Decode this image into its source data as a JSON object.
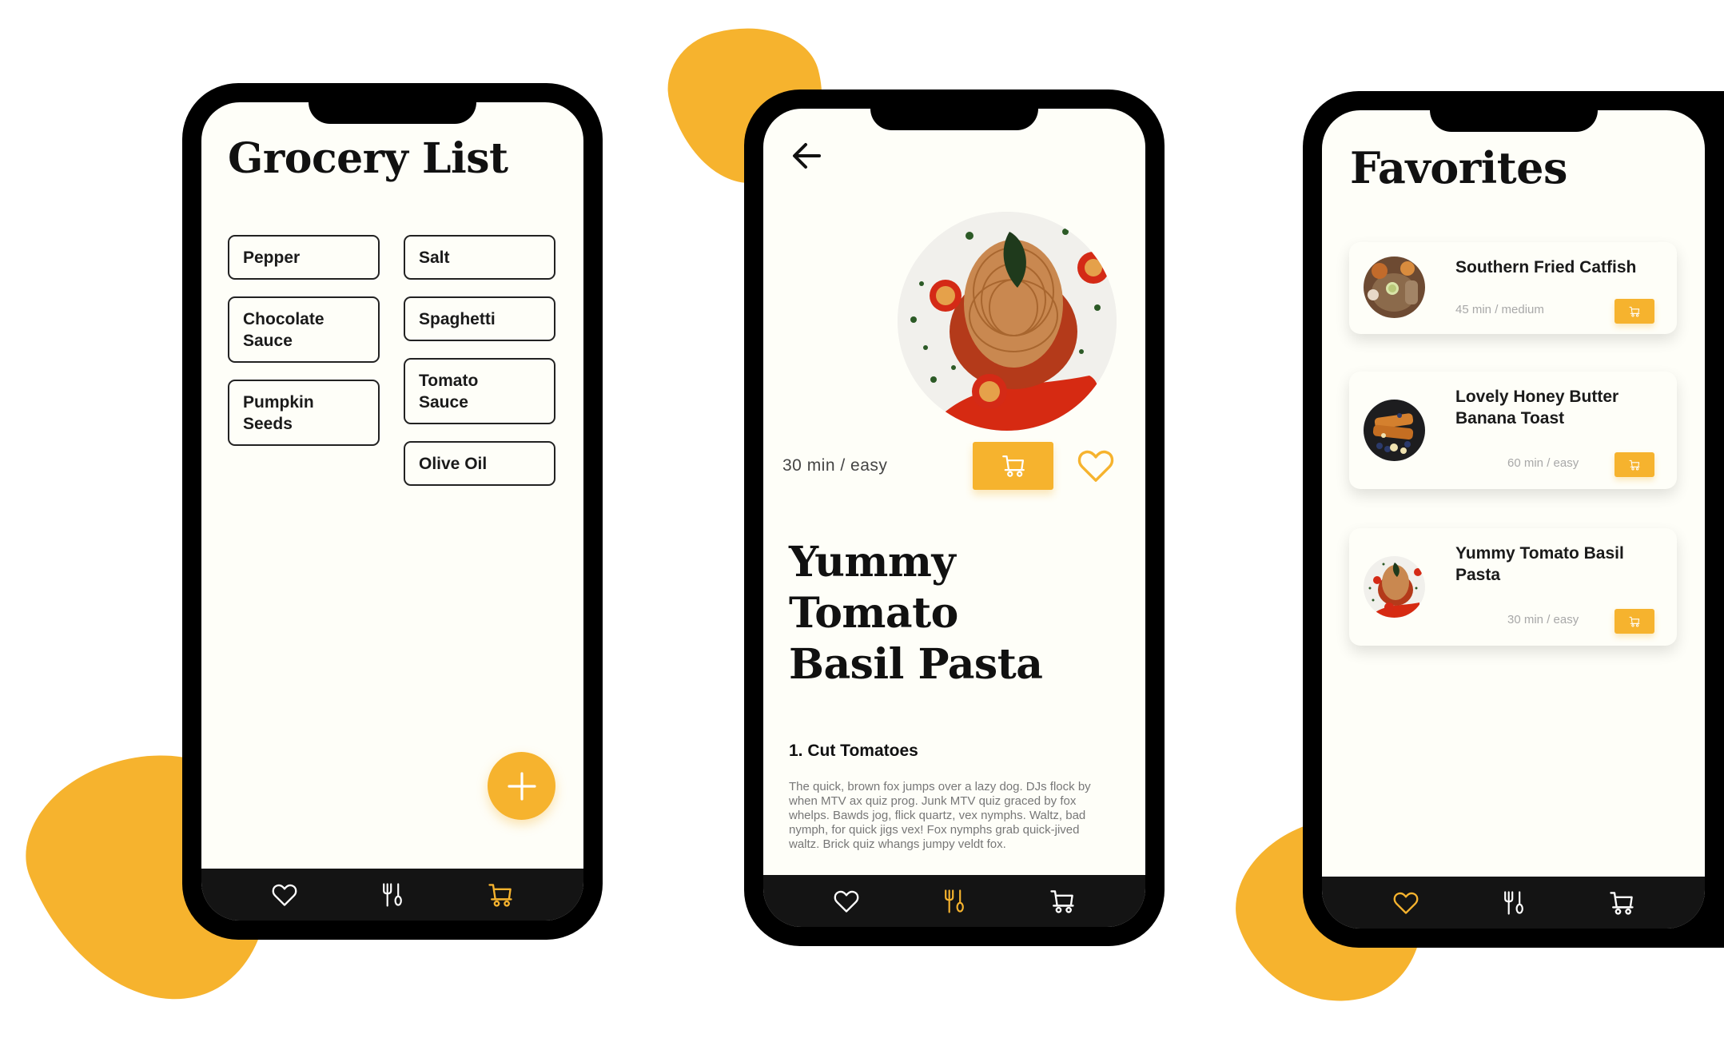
{
  "colors": {
    "accent": "#F6B32E",
    "screen_bg": "#FEFEF8",
    "tabbar_bg": "#141414",
    "text_dark": "#111111",
    "text_muted": "#A8A8A8"
  },
  "grocery_screen": {
    "title": "Grocery List",
    "column_1": [
      "Pepper",
      "Chocolate\nSauce",
      "Pumpkin\nSeeds"
    ],
    "column_2": [
      "Salt",
      "Spaghetti",
      "Tomato\nSauce",
      "Olive Oil"
    ],
    "fab_icon": "plus-icon",
    "tabbar": {
      "items": [
        {
          "icon": "heart-icon",
          "label": "Favorites",
          "active": false
        },
        {
          "icon": "fork-spoon-icon",
          "label": "Recipes",
          "active": false
        },
        {
          "icon": "cart-icon",
          "label": "Grocery List",
          "active": true
        }
      ]
    }
  },
  "recipe_screen": {
    "back_icon": "arrow-left-icon",
    "hero_image": "spaghetti-with-tomatoes-photo",
    "meta": "30 min / easy",
    "cart_button_icon": "cart-icon",
    "favorite_icon": "heart-icon",
    "title": "Yummy Tomato Basil Pasta",
    "step": {
      "title": "1. Cut Tomatoes",
      "body": "The quick, brown fox jumps over a lazy dog. DJs flock by when MTV ax quiz prog. Junk MTV quiz graced by fox whelps. Bawds jog, flick quartz, vex nymphs. Waltz, bad nymph, for quick jigs vex! Fox nymphs grab quick-jived waltz. Brick quiz whangs jumpy veldt fox."
    },
    "tabbar": {
      "items": [
        {
          "icon": "heart-icon",
          "label": "Favorites",
          "active": false
        },
        {
          "icon": "fork-spoon-icon",
          "label": "Recipes",
          "active": true
        },
        {
          "icon": "cart-icon",
          "label": "Grocery List",
          "active": false
        }
      ]
    }
  },
  "favorites_screen": {
    "title": "Favorites",
    "cards": [
      {
        "name": "Southern Fried Catfish",
        "meta": "45 min / medium",
        "image": "fried-catfish-photo"
      },
      {
        "name": "Lovely Honey Butter Banana Toast",
        "meta": "60 min / easy",
        "image": "banana-toast-photo"
      },
      {
        "name": "Yummy Tomato Basil Pasta",
        "meta": "30 min / easy",
        "image": "spaghetti-photo"
      }
    ],
    "tabbar": {
      "items": [
        {
          "icon": "heart-icon",
          "label": "Favorites",
          "active": true
        },
        {
          "icon": "fork-spoon-icon",
          "label": "Recipes",
          "active": false
        },
        {
          "icon": "cart-icon",
          "label": "Grocery List",
          "active": false
        }
      ]
    }
  }
}
